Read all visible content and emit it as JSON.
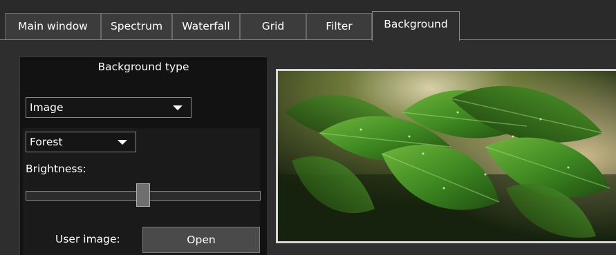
{
  "tabs": [
    {
      "label": "Main window",
      "active": false
    },
    {
      "label": "Spectrum",
      "active": false
    },
    {
      "label": "Waterfall",
      "active": false
    },
    {
      "label": "Grid",
      "active": false
    },
    {
      "label": "Filter",
      "active": false
    },
    {
      "label": "Background",
      "active": true
    }
  ],
  "background": {
    "group_title": "Background type",
    "type_select": {
      "selected": "Image"
    },
    "image_select": {
      "selected": "Forest"
    },
    "brightness_label": "Brightness:",
    "brightness_value": 0.5,
    "user_image_label": "User image:",
    "open_button": "Open"
  },
  "preview": {
    "image_subject": "forest leaves"
  },
  "colors": {
    "background": "#2e2e2e",
    "panel": "#121212",
    "border": "#8a8a8a",
    "text": "#ffffff"
  }
}
